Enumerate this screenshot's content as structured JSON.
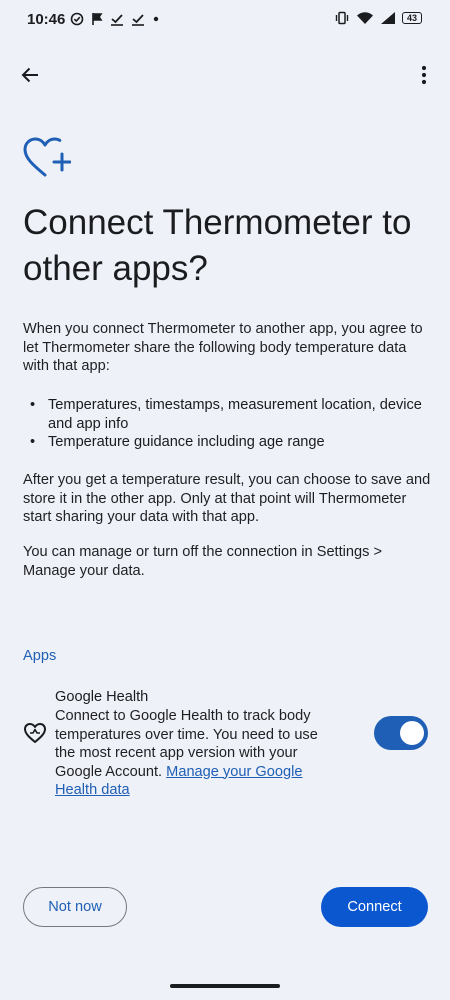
{
  "status_bar": {
    "time": "10:46",
    "battery": "43",
    "left_icons": [
      "sync-check-icon",
      "flag-icon",
      "check-icon",
      "check-icon",
      "dot-icon"
    ],
    "right_icons": [
      "vibrate-icon",
      "wifi-icon",
      "signal-icon",
      "battery-icon"
    ]
  },
  "app_bar": {
    "back_icon": "arrow-back-icon",
    "more_icon": "more-vert-icon"
  },
  "hero": {
    "icon": "heart-plus-icon",
    "accent": "#1f5fb6"
  },
  "title": "Connect Thermometer to other apps?",
  "intro": "When you connect Thermometer to another app, you agree to let Thermometer share the following body temperature data with that app:",
  "bullets": [
    "Temperatures, timestamps, measurement location, device and app info",
    "Temperature guidance including age range"
  ],
  "bullet_symbol": "•",
  "paragraph2": "After you get a temperature result, you can choose to save and store it in the other app. Only at that point will Thermometer start sharing your data with that app.",
  "paragraph3": "You can manage or turn off the connection in Settings > Manage your data.",
  "apps_section": {
    "label": "Apps",
    "items": [
      {
        "icon": "google-health-icon",
        "name": "Google Health",
        "description": "Connect to Google Health to track body temperatures over time. You need to use the most recent app version with your Google Account.",
        "link": "Manage your Google Health data",
        "enabled": true
      }
    ]
  },
  "buttons": {
    "not_now": "Not now",
    "connect": "Connect"
  },
  "colors": {
    "background": "#eef1f7",
    "accent": "#1f5fb6",
    "primary_button": "#0b57d0"
  }
}
